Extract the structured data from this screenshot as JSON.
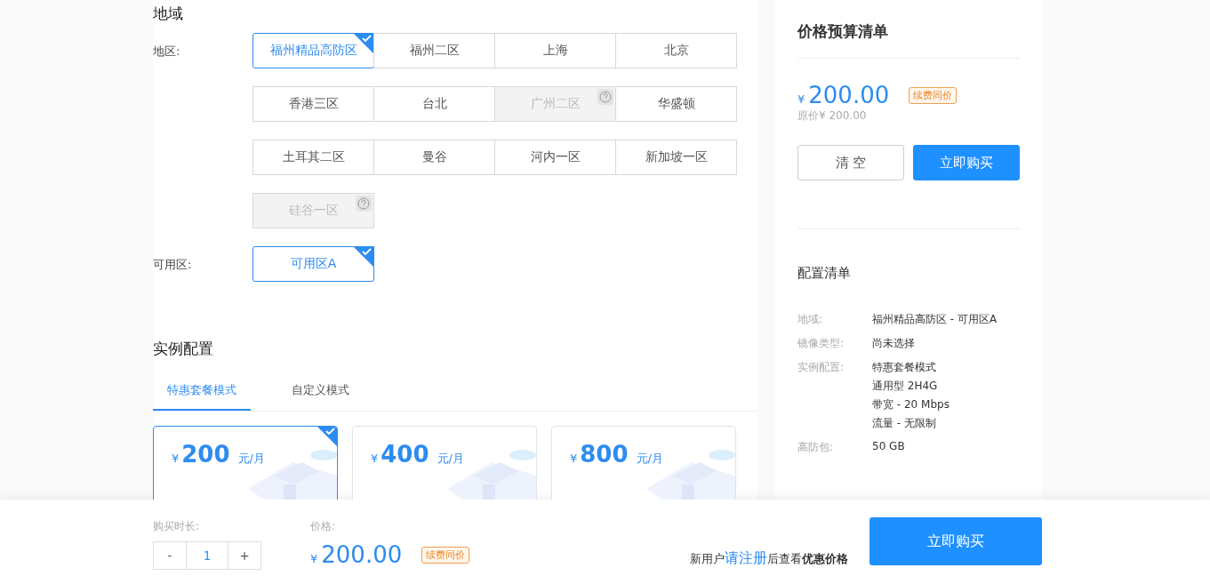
{
  "region_section": {
    "title": "地域",
    "region_label": "地区:",
    "regions": [
      {
        "label": "福州精品高防区",
        "selected": true,
        "disabled": false
      },
      {
        "label": "福州二区",
        "selected": false,
        "disabled": false
      },
      {
        "label": "上海",
        "selected": false,
        "disabled": false
      },
      {
        "label": "北京",
        "selected": false,
        "disabled": false
      },
      {
        "label": "香港三区",
        "selected": false,
        "disabled": false
      },
      {
        "label": "台北",
        "selected": false,
        "disabled": false
      },
      {
        "label": "广州二区",
        "selected": false,
        "disabled": true
      },
      {
        "label": "华盛顿",
        "selected": false,
        "disabled": false
      },
      {
        "label": "土耳其二区",
        "selected": false,
        "disabled": false
      },
      {
        "label": "曼谷",
        "selected": false,
        "disabled": false
      },
      {
        "label": "河内一区",
        "selected": false,
        "disabled": false
      },
      {
        "label": "新加坡一区",
        "selected": false,
        "disabled": false
      },
      {
        "label": "硅谷一区",
        "selected": false,
        "disabled": true
      }
    ],
    "zone_label": "可用区:",
    "zones": [
      {
        "label": "可用区A",
        "selected": true,
        "disabled": false
      }
    ]
  },
  "instance_section": {
    "title": "实例配置",
    "tabs": [
      {
        "label": "特惠套餐模式",
        "selected": true
      },
      {
        "label": "自定义模式",
        "selected": false
      }
    ],
    "plans": [
      {
        "currency": "¥",
        "price": "200",
        "unit": "元/月",
        "selected": true
      },
      {
        "currency": "¥",
        "price": "400",
        "unit": "元/月",
        "selected": false
      },
      {
        "currency": "¥",
        "price": "800",
        "unit": "元/月",
        "selected": false
      }
    ]
  },
  "budget": {
    "title": "价格预算清单",
    "currency": "¥",
    "price": "200.00",
    "badge": "续费同价",
    "original_price": "原价¥ 200.00",
    "buttons": [
      {
        "label": "清 空",
        "kind": "secondary"
      },
      {
        "label": "立即购买",
        "kind": "primary"
      }
    ],
    "config_title": "配置清单",
    "config": [
      {
        "label": "地域:",
        "values": [
          "福州精品高防区 - 可用区A"
        ]
      },
      {
        "label": "镜像类型:",
        "values": [
          "尚未选择"
        ]
      },
      {
        "label": "实例配置:",
        "values": [
          "特惠套餐模式",
          "通用型 2H4G",
          "带宽 - 20 Mbps",
          "流量 - 无限制"
        ]
      },
      {
        "label": "高防包:",
        "values": [
          "50 GB"
        ]
      }
    ]
  },
  "footer": {
    "duration_label": "购买时长:",
    "minus": "-",
    "quantity": "1",
    "plus": "+",
    "price_label": "价格:",
    "currency": "¥",
    "price": "200.00",
    "badge": "续费同价",
    "promo_prefix": "新用户",
    "register_link": "请注册",
    "promo_suffix": "后查看**优惠价格**",
    "buy_button": "立即购买"
  }
}
